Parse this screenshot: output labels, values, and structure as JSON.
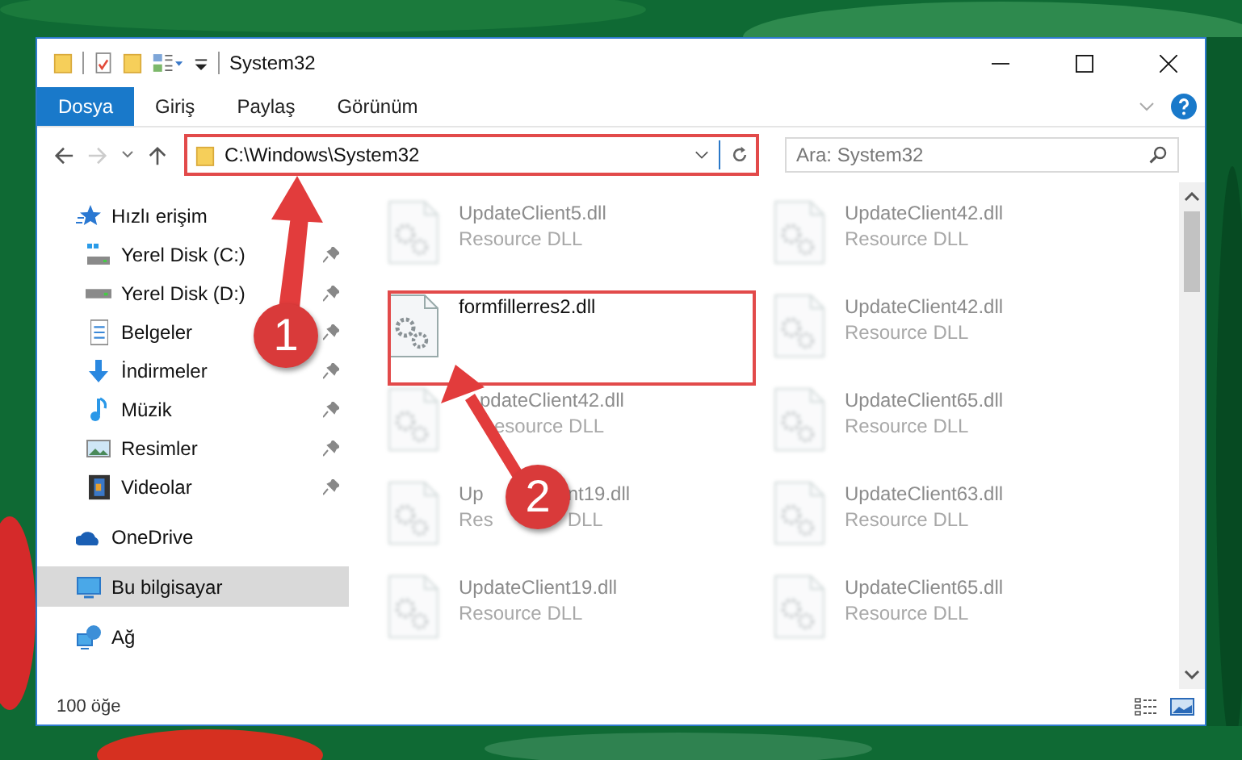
{
  "window": {
    "title": "System32"
  },
  "ribbon_tabs": [
    {
      "label": "Dosya",
      "selected": true
    },
    {
      "label": "Giriş",
      "selected": false
    },
    {
      "label": "Paylaş",
      "selected": false
    },
    {
      "label": "Görünüm",
      "selected": false
    }
  ],
  "address": {
    "path": "C:\\Windows\\System32"
  },
  "search": {
    "placeholder": "Ara: System32"
  },
  "sidebar": {
    "items": [
      {
        "label": "Hızlı erişim",
        "selected": false,
        "children": [
          {
            "label": "Yerel Disk (C:)",
            "pinned": true,
            "selected": false
          },
          {
            "label": "Yerel Disk (D:)",
            "pinned": true,
            "selected": false
          },
          {
            "label": "Belgeler",
            "pinned": true,
            "selected": false
          },
          {
            "label": "İndirmeler",
            "pinned": true,
            "selected": false
          },
          {
            "label": "Müzik",
            "pinned": true,
            "selected": false
          },
          {
            "label": "Resimler",
            "pinned": true,
            "selected": false
          },
          {
            "label": "Videolar",
            "pinned": true,
            "selected": false
          }
        ]
      },
      {
        "label": "OneDrive",
        "selected": false
      },
      {
        "label": "Bu bilgisayar",
        "selected": true
      },
      {
        "label": "Ağ",
        "selected": false
      }
    ]
  },
  "files": [
    {
      "kind": "plain",
      "name": "UpdateClient5.dll",
      "type": "Resource DLL",
      "blurred": true
    },
    {
      "kind": "plain",
      "name": "UpdateClient42.dll",
      "type": "Resource DLL",
      "blurred": true
    },
    {
      "kind": "plain",
      "name": "formfillerres2.dll",
      "blurred": false
    },
    {
      "kind": "plain",
      "name": "UpdateClient42.dll",
      "type": "Resource DLL",
      "blurred": true
    },
    {
      "kind": "cut-left",
      "name": "pdateClient42.dll",
      "type": "esource DLL",
      "blurred": true
    },
    {
      "kind": "plain",
      "name": "UpdateClient65.dll",
      "type": "Resource DLL",
      "blurred": true
    },
    {
      "kind": "split",
      "name": "Up",
      "name_rest": "nt19.dll",
      "type": "Res",
      "type_rest": "DLL",
      "blurred": true
    },
    {
      "kind": "plain",
      "name": "UpdateClient63.dll",
      "type": "Resource DLL",
      "blurred": true
    },
    {
      "kind": "plain",
      "name": "UpdateClient19.dll",
      "type": "Resource DLL",
      "blurred": true
    },
    {
      "kind": "plain",
      "name": "UpdateClient65.dll",
      "type": "Resource DLL",
      "blurred": true
    }
  ],
  "status_bar": {
    "count": "100 öğe"
  },
  "annotations": [
    {
      "number": "1"
    },
    {
      "number": "2"
    }
  ]
}
